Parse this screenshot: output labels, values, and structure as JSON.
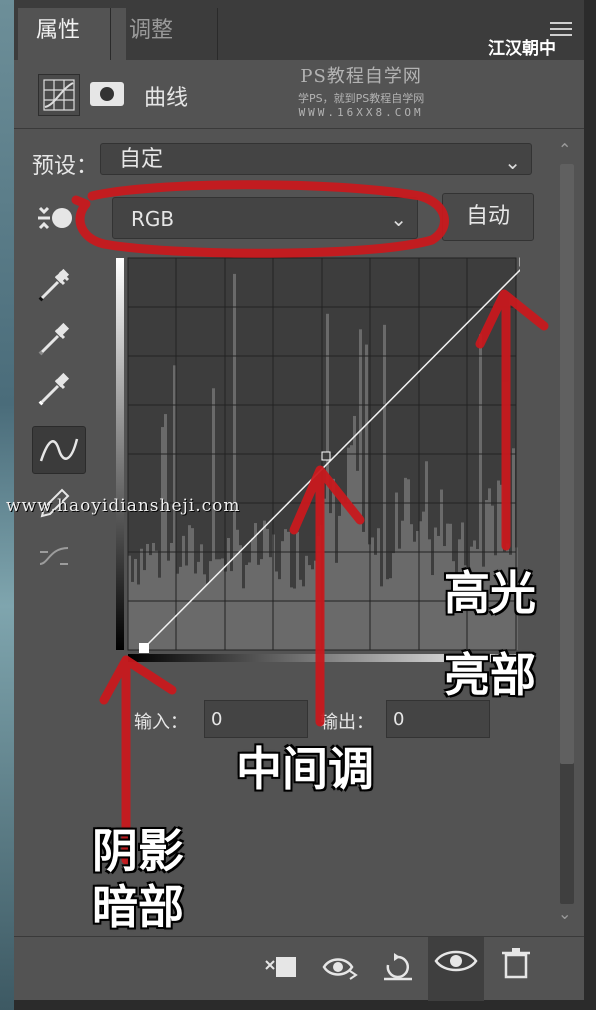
{
  "tabs": {
    "properties": "属性",
    "adjustments": "调整"
  },
  "header": {
    "title": "曲线"
  },
  "watermark": {
    "line1": "PS教程自学网",
    "line2": "学PS，就到PS教程自学网",
    "line3": "WWW.16XX8.COM"
  },
  "preset": {
    "label": "预设：",
    "value": "自定"
  },
  "channel": {
    "value": "RGB"
  },
  "auto_button": "自动",
  "io": {
    "input_label": "输入：",
    "input_value": "0",
    "output_label": "输出：",
    "output_value": "0"
  },
  "annotations": {
    "highlights": [
      "高光",
      "亮部"
    ],
    "midtones": "中间调",
    "shadows": [
      "阴影",
      "暗部"
    ]
  },
  "site_watermark": "www.haoyidiansheji.com",
  "brand": "江汉朝中",
  "colors": {
    "panel": "#535353",
    "tabbar": "#3c3c3c",
    "annotation_red": "#c8191e"
  },
  "icons": [
    "curves-grid-icon",
    "mask-icon",
    "menu-icon",
    "target-adjust-icon",
    "black-point-eyedropper-icon",
    "gray-point-eyedropper-icon",
    "white-point-eyedropper-icon",
    "curve-point-icon",
    "pencil-icon",
    "smooth-icon",
    "clip-to-layer-icon",
    "view-previous-icon",
    "reset-icon",
    "visibility-eye-icon",
    "trash-icon"
  ]
}
